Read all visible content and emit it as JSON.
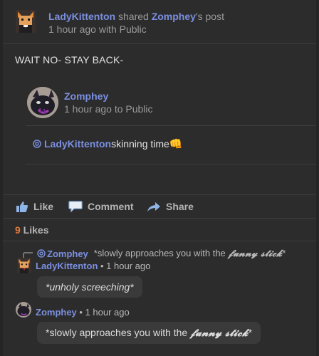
{
  "post": {
    "author": "LadyKittenton",
    "action_text": " shared ",
    "shared_from": "Zomphey",
    "shared_from_suffix": "'s post",
    "time": "1 hour ago with Public",
    "text": "WAIT NO- STAY BACK-"
  },
  "shared_post": {
    "author": "Zomphey",
    "time": "1 hour ago to Public",
    "mention": "LadyKittenton",
    "body": " skinning time ",
    "emoji": "👊"
  },
  "actions": {
    "like": "Like",
    "comment": "Comment",
    "share": "Share"
  },
  "likes": {
    "count": "9",
    "label": " Likes"
  },
  "comments": {
    "reply_ref_author": "Zomphey",
    "reply_ref_text_plain": "*slowly approaches you with the ",
    "reply_ref_text_fancy": "𝓯𝓾𝓷𝓷𝔂 𝓼𝓽𝓲𝓬𝓴",
    "reply_ref_text_end": "*",
    "c1_author": "LadyKittenton",
    "c1_time": " • 1 hour ago",
    "c1_text": "*unholy screeching*",
    "c2_author": "Zomphey",
    "c2_time": " • 1 hour ago",
    "c2_text_plain": "*slowly approaches you with the ",
    "c2_text_fancy": "𝓯𝓾𝓷𝓷𝔂 𝓼𝓽𝓲𝓬𝓴",
    "c2_text_end": "*"
  },
  "colors": {
    "background": "#2c2c2d",
    "link": "#7b8fe0",
    "likes_count": "#e07a3a",
    "bubble": "#3a3a3b"
  }
}
